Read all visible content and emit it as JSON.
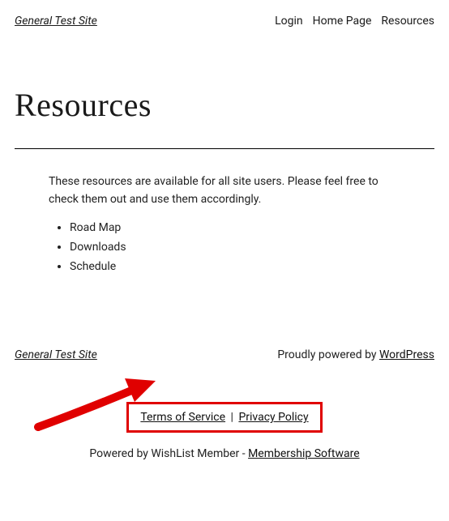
{
  "header": {
    "site_title": "General Test Site",
    "nav": [
      {
        "label": "Login"
      },
      {
        "label": "Home Page"
      },
      {
        "label": "Resources"
      }
    ]
  },
  "page": {
    "title": "Resources",
    "intro": "These resources are available for all site users. Please feel free to check them out and use them accordingly.",
    "items": [
      "Road Map",
      "Downloads",
      "Schedule"
    ]
  },
  "footer": {
    "site_title": "General Test Site",
    "powered_prefix": "Proudly powered by ",
    "powered_link": "WordPress",
    "legal": {
      "tos": "Terms of Service",
      "sep": " | ",
      "privacy": "Privacy Policy"
    },
    "credit_prefix": "Powered by WishList Member - ",
    "credit_link": "Membership Software"
  }
}
